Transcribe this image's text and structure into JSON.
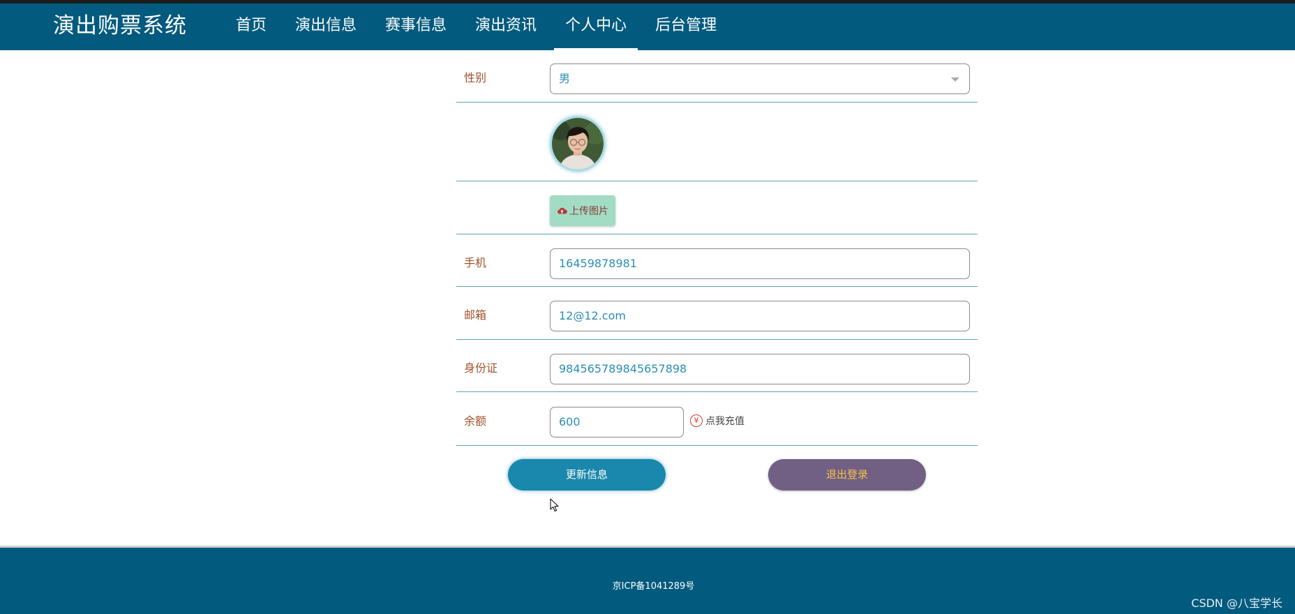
{
  "header": {
    "brand": "演出购票系统",
    "nav": [
      {
        "label": "首页"
      },
      {
        "label": "演出信息"
      },
      {
        "label": "赛事信息"
      },
      {
        "label": "演出资讯"
      },
      {
        "label": "个人中心",
        "active": true
      },
      {
        "label": "后台管理"
      }
    ]
  },
  "form": {
    "gender": {
      "label": "性别",
      "value": "男"
    },
    "avatar": {
      "icon": "user-avatar-photo"
    },
    "upload": {
      "label": "上传图片",
      "icon": "cloud-upload-icon"
    },
    "phone": {
      "label": "手机",
      "value": "16459878981"
    },
    "email": {
      "label": "邮箱",
      "value": "12@12.com"
    },
    "id_card": {
      "label": "身份证",
      "value": "984565789845657898"
    },
    "balance": {
      "label": "余额",
      "value": "600",
      "recharge_label": "点我充值",
      "recharge_icon": "yen-circle-icon",
      "yen_symbol": "¥"
    }
  },
  "actions": {
    "update_label": "更新信息",
    "logout_label": "退出登录"
  },
  "footer": {
    "icp": "京ICP备1041289号",
    "watermark": "CSDN @八宝学长"
  },
  "colors": {
    "header_bg": "#025a7e",
    "label_text": "#a0522d",
    "value_text": "#2a8fb5",
    "update_button": "#1a87ad",
    "logout_button": "#725f84",
    "logout_text": "#f4c24a",
    "upload_button": "#a3dcc4"
  }
}
